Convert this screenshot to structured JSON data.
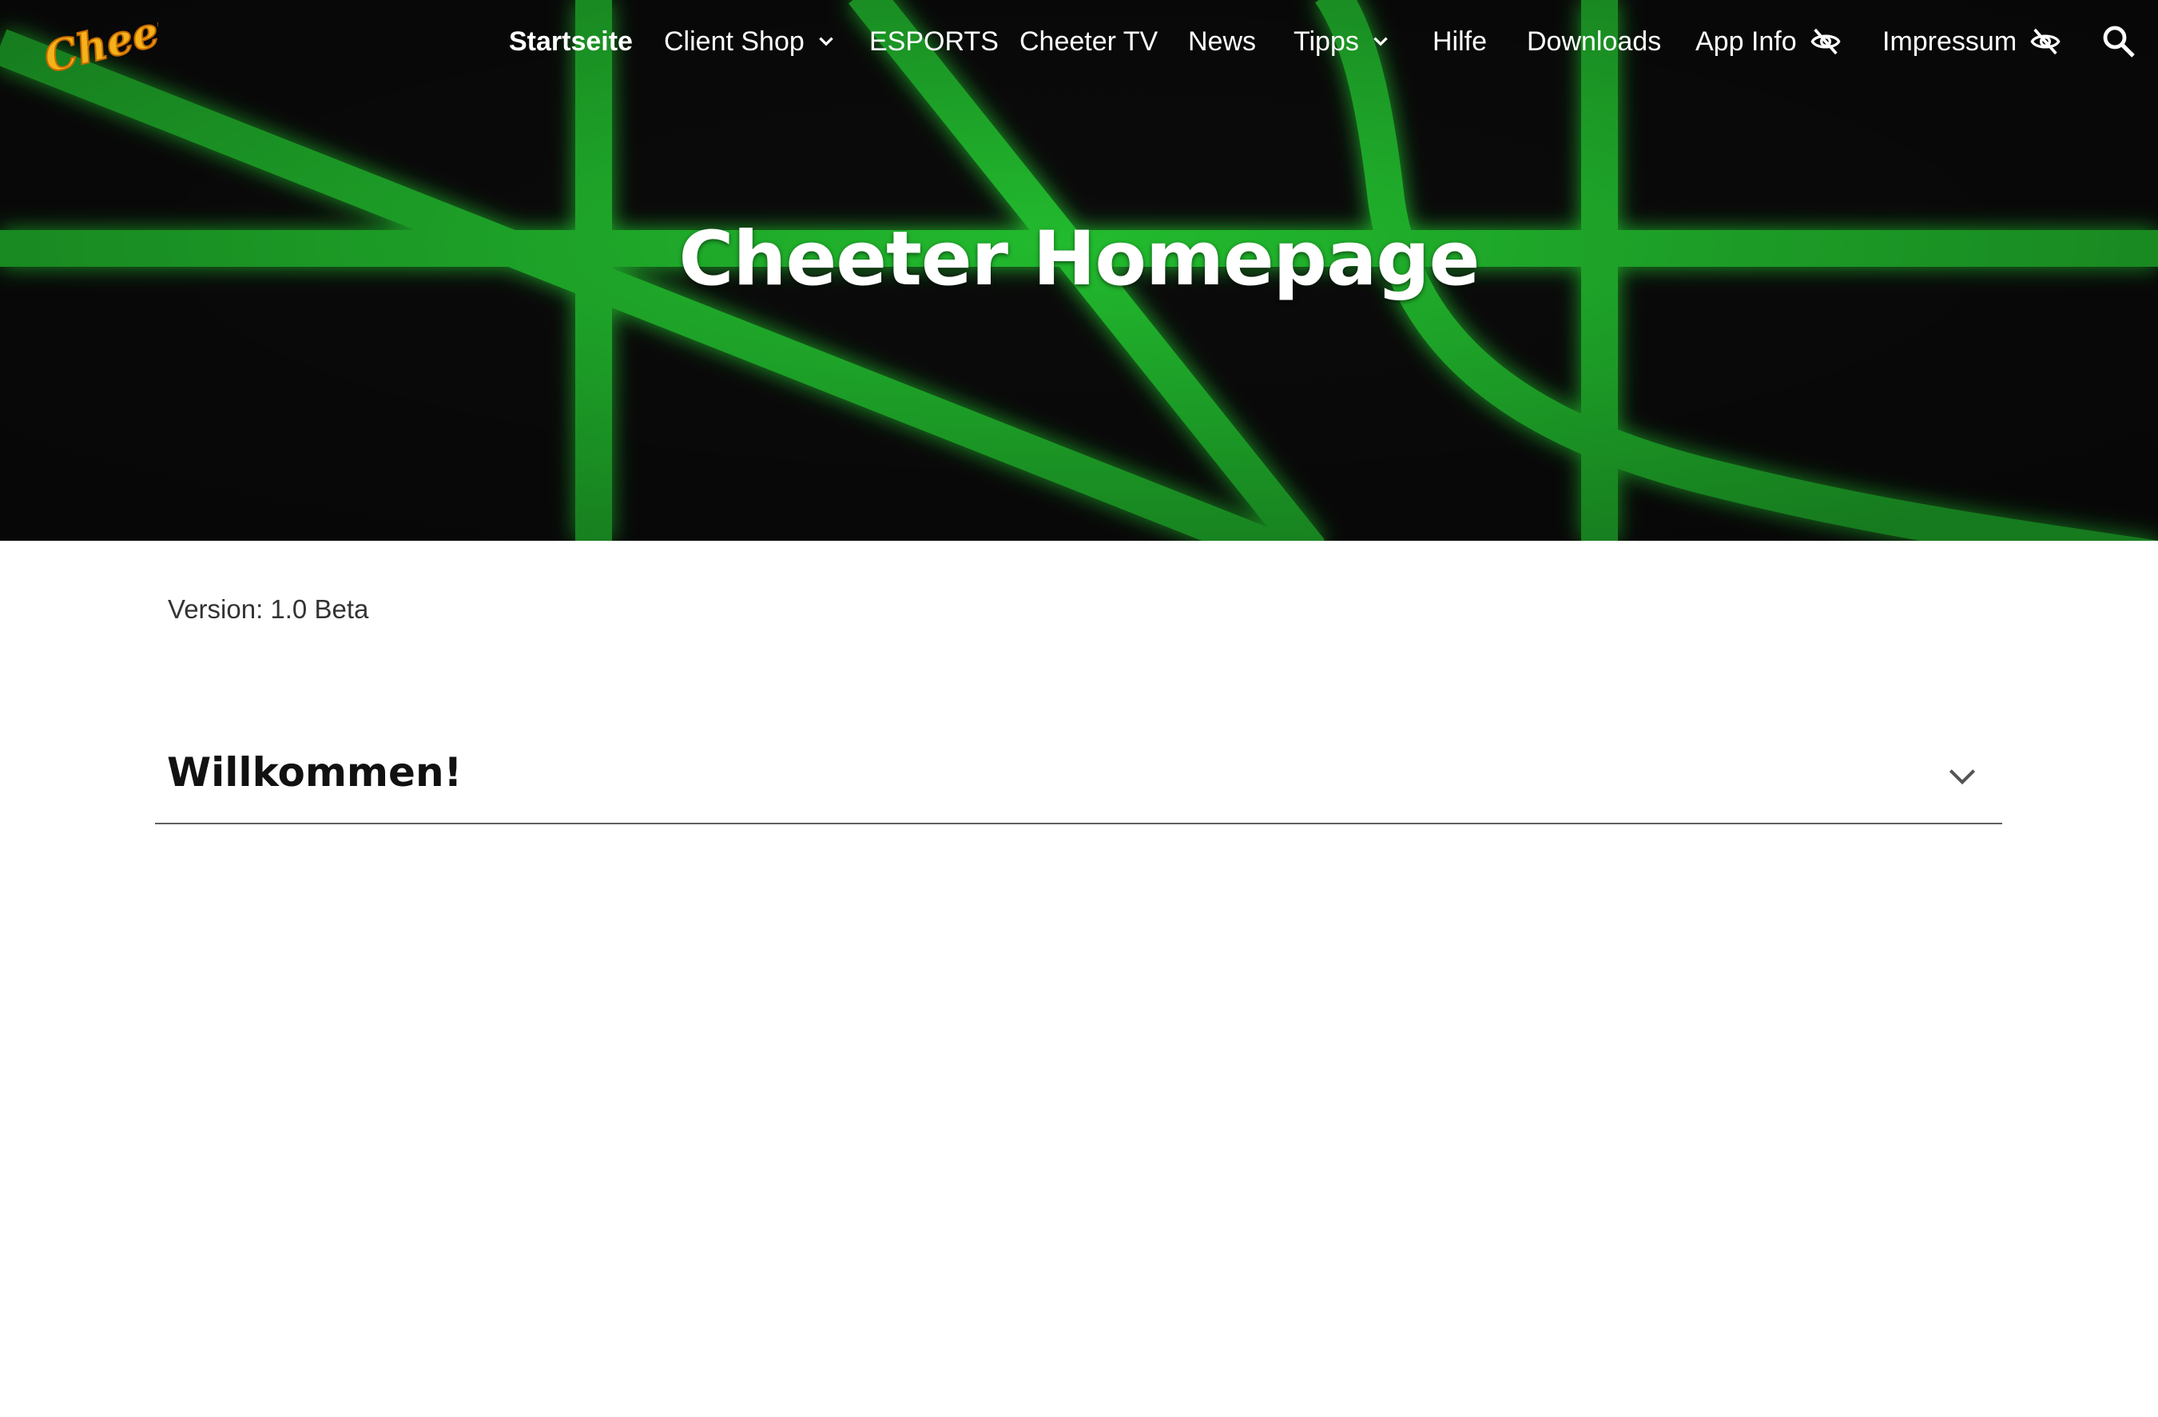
{
  "header": {
    "logo_text": "Cheeter",
    "nav": [
      {
        "label": "Startseite",
        "active": true
      },
      {
        "label": "Client Shop",
        "icon": "chevron-down-icon"
      },
      {
        "label": "ESPORTS"
      },
      {
        "label": "Cheeter TV"
      },
      {
        "label": "News"
      },
      {
        "label": "Tipps",
        "icon": "chevron-down-icon"
      },
      {
        "label": "Hilfe"
      },
      {
        "label": "Downloads"
      },
      {
        "label": "App Info",
        "icon": "eye-off-icon"
      },
      {
        "label": "Impressum",
        "icon": "eye-off-icon"
      }
    ],
    "search_icon": "search-icon"
  },
  "hero": {
    "title": "Cheeter Homepage",
    "background_color": "#0b0b0b",
    "line_color": "#22bb2e"
  },
  "main": {
    "version_text": "Version: 1.0 Beta",
    "accordion": {
      "title": "Willkommen!",
      "icon": "chevron-down-icon",
      "expanded": false
    }
  }
}
